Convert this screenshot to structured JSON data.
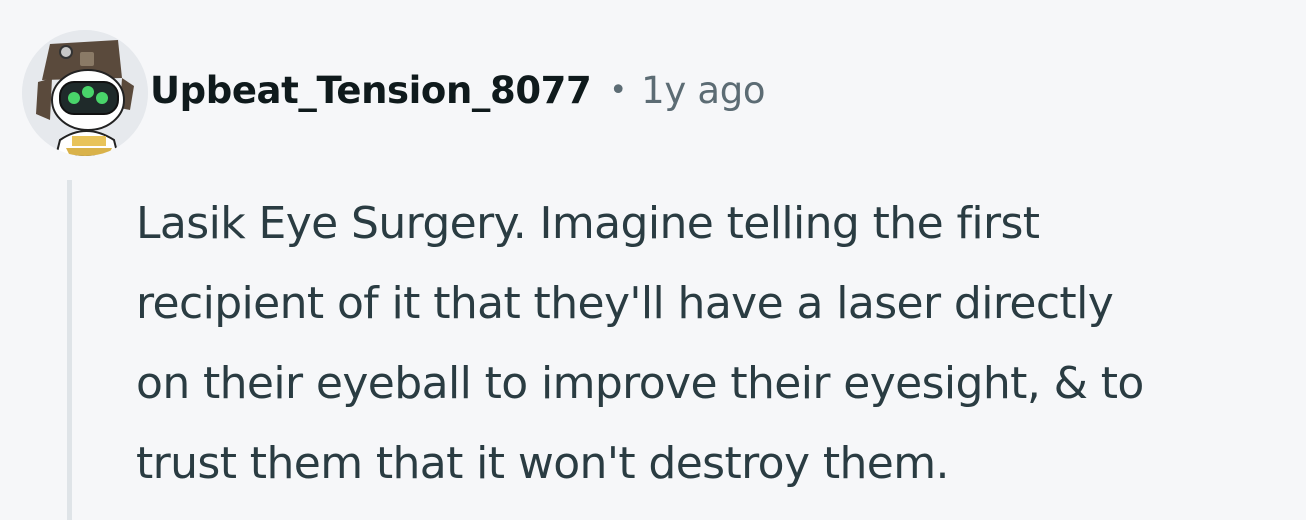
{
  "comment": {
    "author": "Upbeat_Tension_8077",
    "separator": "•",
    "timestamp": "1y ago",
    "avatar_icon": "robot-snoo-avatar-icon",
    "body_lines": [
      "Lasik Eye Surgery. Imagine telling the first",
      "recipient of it that they'll have a laser directly",
      "on their eyeball to improve their eyesight, & to",
      "trust them that it won't destroy them."
    ]
  },
  "colors": {
    "background": "#f6f7f9",
    "author": "#0f1a1c",
    "meta": "#5c6c74",
    "body": "#2a3c42",
    "thread_line": "#dfe4e8"
  }
}
